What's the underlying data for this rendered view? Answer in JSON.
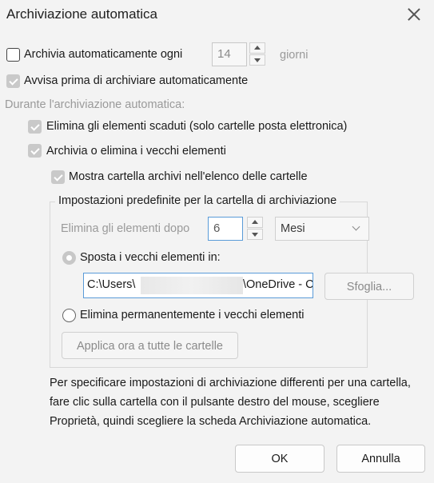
{
  "dialog": {
    "title": "Archiviazione automatica"
  },
  "options": {
    "auto_archive_label": "Archivia automaticamente ogni",
    "auto_archive_days": "14",
    "days_unit": "giorni",
    "prompt_label": "Avvisa prima di archiviare automaticamente",
    "during_label": "Durante l'archiviazione automatica:",
    "delete_expired_label": "Elimina gli elementi scaduti (solo cartelle posta elettronica)",
    "archive_old_label": "Archivia o elimina i vecchi elementi",
    "show_folder_label": "Mostra cartella archivi nell'elenco delle cartelle"
  },
  "defaults_group": {
    "title": "Impostazioni predefinite per la cartella di archiviazione",
    "clean_after_label": "Elimina gli elementi dopo",
    "clean_after_value": "6",
    "clean_after_unit": "Mesi",
    "move_label": "Sposta i vecchi elementi in:",
    "path_start": "C:\\Users\\",
    "path_end": "\\OneDrive - C",
    "browse_label": "Sfoglia...",
    "delete_perm_label": "Elimina permanentemente i vecchi elementi",
    "apply_all_label": "Applica ora a tutte le cartelle"
  },
  "footer": {
    "info_text": "Per specificare impostazioni di archiviazione differenti per una cartella, fare clic sulla cartella con il pulsante destro del mouse, scegliere Proprietà, quindi scegliere la scheda Archiviazione automatica.",
    "ok_label": "OK",
    "cancel_label": "Annulla"
  }
}
